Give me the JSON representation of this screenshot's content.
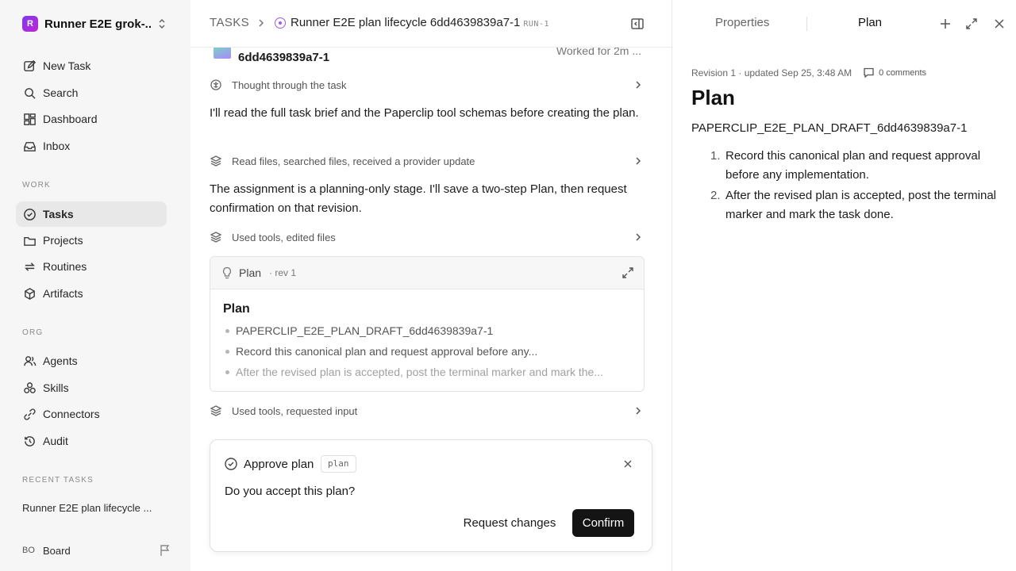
{
  "workspace": {
    "initial": "R",
    "name": "Runner E2E grok-..."
  },
  "sidebar": {
    "top_items": [
      {
        "label": "New Task",
        "icon": "new-task-icon"
      },
      {
        "label": "Search",
        "icon": "search-icon"
      },
      {
        "label": "Dashboard",
        "icon": "dashboard-icon"
      },
      {
        "label": "Inbox",
        "icon": "inbox-icon"
      }
    ],
    "work_label": "WORK",
    "work_items": [
      {
        "label": "Tasks",
        "icon": "tasks-icon",
        "active": true
      },
      {
        "label": "Projects",
        "icon": "folder-icon"
      },
      {
        "label": "Routines",
        "icon": "routines-icon"
      },
      {
        "label": "Artifacts",
        "icon": "cube-icon"
      }
    ],
    "org_label": "ORG",
    "org_items": [
      {
        "label": "Agents",
        "icon": "agents-icon"
      },
      {
        "label": "Skills",
        "icon": "skills-icon"
      },
      {
        "label": "Connectors",
        "icon": "connectors-icon"
      },
      {
        "label": "Audit",
        "icon": "history-icon"
      }
    ],
    "recent_label": "RECENT TASKS",
    "recent_task": "Runner E2E plan lifecycle ...",
    "board": {
      "initials": "BO",
      "name": "Board"
    }
  },
  "header": {
    "root": "TASKS",
    "title": "Runner E2E plan lifecycle 6dd4639839a7-1",
    "run_tag": "RUN-1"
  },
  "thread": {
    "partial_title": "6dd4639839a7-1",
    "worked": "Worked for 2m ...",
    "activity_1": "Thought through the task",
    "para_1": "I'll read the full task brief and the Paperclip tool schemas before creating the plan.",
    "activity_2": "Read files, searched files, received a provider update",
    "para_2": "The assignment is a planning-only stage. I'll save a two-step Plan, then request confirmation on that revision.",
    "activity_3": "Used tools, edited files",
    "activity_4": "Used tools, requested input"
  },
  "plan_card": {
    "label": "Plan",
    "rev": "· rev 1",
    "title": "Plan",
    "items": [
      "PAPERCLIP_E2E_PLAN_DRAFT_6dd4639839a7-1",
      "Record this canonical plan and request approval before any...",
      "After the revised plan is accepted, post the terminal marker and mark the..."
    ]
  },
  "approval": {
    "title": "Approve plan",
    "tag": "plan",
    "question": "Do you accept this plan?",
    "request_changes": "Request changes",
    "confirm": "Confirm"
  },
  "right_panel": {
    "tab_properties": "Properties",
    "tab_plan": "Plan",
    "meta": "Revision 1 · updated Sep 25, 3:48 AM",
    "comments": "0 comments",
    "title": "Plan",
    "draft_line": "PAPERCLIP_E2E_PLAN_DRAFT_6dd4639839a7-1",
    "steps": [
      {
        "num": "1.",
        "text": "Record this canonical plan and request approval before any implementation."
      },
      {
        "num": "2.",
        "text": "After the revised plan is accepted, post the terminal marker and mark the task done."
      }
    ]
  },
  "colors": {
    "accent_status": "#9b5de5",
    "primary_button": "#141414",
    "sidebar_bg": "#f6f6f6",
    "active_item": "#e8e8e8"
  }
}
